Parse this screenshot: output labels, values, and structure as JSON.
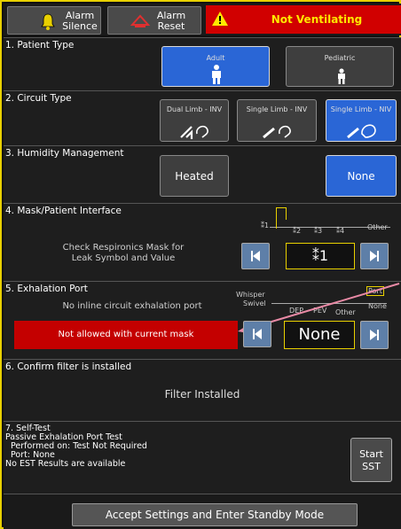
{
  "topbar": {
    "alarm_silence": [
      "Alarm",
      "Silence"
    ],
    "alarm_reset": [
      "Alarm",
      "Reset"
    ],
    "alarm_text": "Not Ventilating"
  },
  "patient_type": {
    "title": "1. Patient Type",
    "options": [
      "Adult",
      "Pediatric"
    ],
    "selected": "Adult"
  },
  "circuit_type": {
    "title": "2. Circuit Type",
    "options": [
      "Dual Limb - INV",
      "Single Limb - INV",
      "Single Limb - NIV"
    ],
    "selected": "Single Limb - NIV"
  },
  "humidity": {
    "title": "3. Humidity Management",
    "options": [
      "Heated",
      "None"
    ],
    "selected": "None"
  },
  "mask": {
    "title": "4. Mask/Patient Interface",
    "help": [
      "Check Respironics Mask for",
      "Leak Symbol and Value"
    ],
    "scale": [
      "⁑1",
      "⁑2",
      "⁑3",
      "⁑4",
      "Other"
    ],
    "value": "⁑1"
  },
  "exhalation": {
    "title": "5. Exhalation Port",
    "note": "No inline circuit exhalation port",
    "scale_left": [
      "Whisper",
      "Swivel"
    ],
    "scale": [
      "DEP",
      "PEV",
      "Other"
    ],
    "scale_right": [
      "Port",
      "None"
    ],
    "value": "None",
    "error": "Not allowed with current mask"
  },
  "filter": {
    "title": "6. Confirm filter is installed",
    "status": "Filter Installed"
  },
  "selftest": {
    "lines": [
      "7. Self-Test",
      "Passive Exhalation Port Test",
      "  Performed on: Test Not Required",
      "  Port: None",
      "No EST Results are available"
    ],
    "start_label": [
      "Start",
      "SST"
    ]
  },
  "footer": {
    "accept_label": "Accept Settings and Enter Standby Mode"
  },
  "colors": {
    "selected": "#2a66d6",
    "alarm": "#d10000",
    "alarm_text": "#ffe800",
    "frame": "#e8d000",
    "error": "#c40000"
  }
}
